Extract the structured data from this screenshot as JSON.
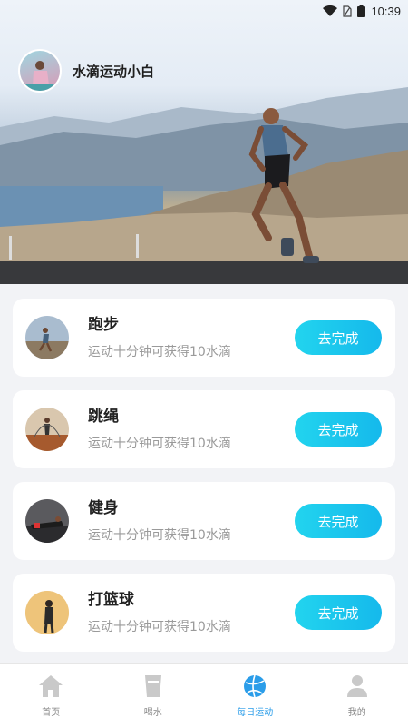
{
  "status_bar": {
    "time": "10:39"
  },
  "profile": {
    "name": "水滴运动小白"
  },
  "tasks": [
    {
      "title": "跑步",
      "desc": "运动十分钟可获得10水滴",
      "button": "去完成",
      "icon": "running-photo"
    },
    {
      "title": "跳绳",
      "desc": "运动十分钟可获得10水滴",
      "button": "去完成",
      "icon": "jump-rope-photo"
    },
    {
      "title": "健身",
      "desc": "运动十分钟可获得10水滴",
      "button": "去完成",
      "icon": "fitness-photo"
    },
    {
      "title": "打篮球",
      "desc": "运动十分钟可获得10水滴",
      "button": "去完成",
      "icon": "basketball-photo"
    }
  ],
  "tab_bar": {
    "tabs": [
      {
        "label": "首页",
        "icon": "home-icon"
      },
      {
        "label": "喝水",
        "icon": "cup-icon"
      },
      {
        "label": "每日运动",
        "icon": "ball-icon",
        "active": true
      },
      {
        "label": "我的",
        "icon": "user-icon"
      }
    ]
  },
  "colors": {
    "accent": "#15b9ec",
    "active_tab": "#2b9de9"
  }
}
